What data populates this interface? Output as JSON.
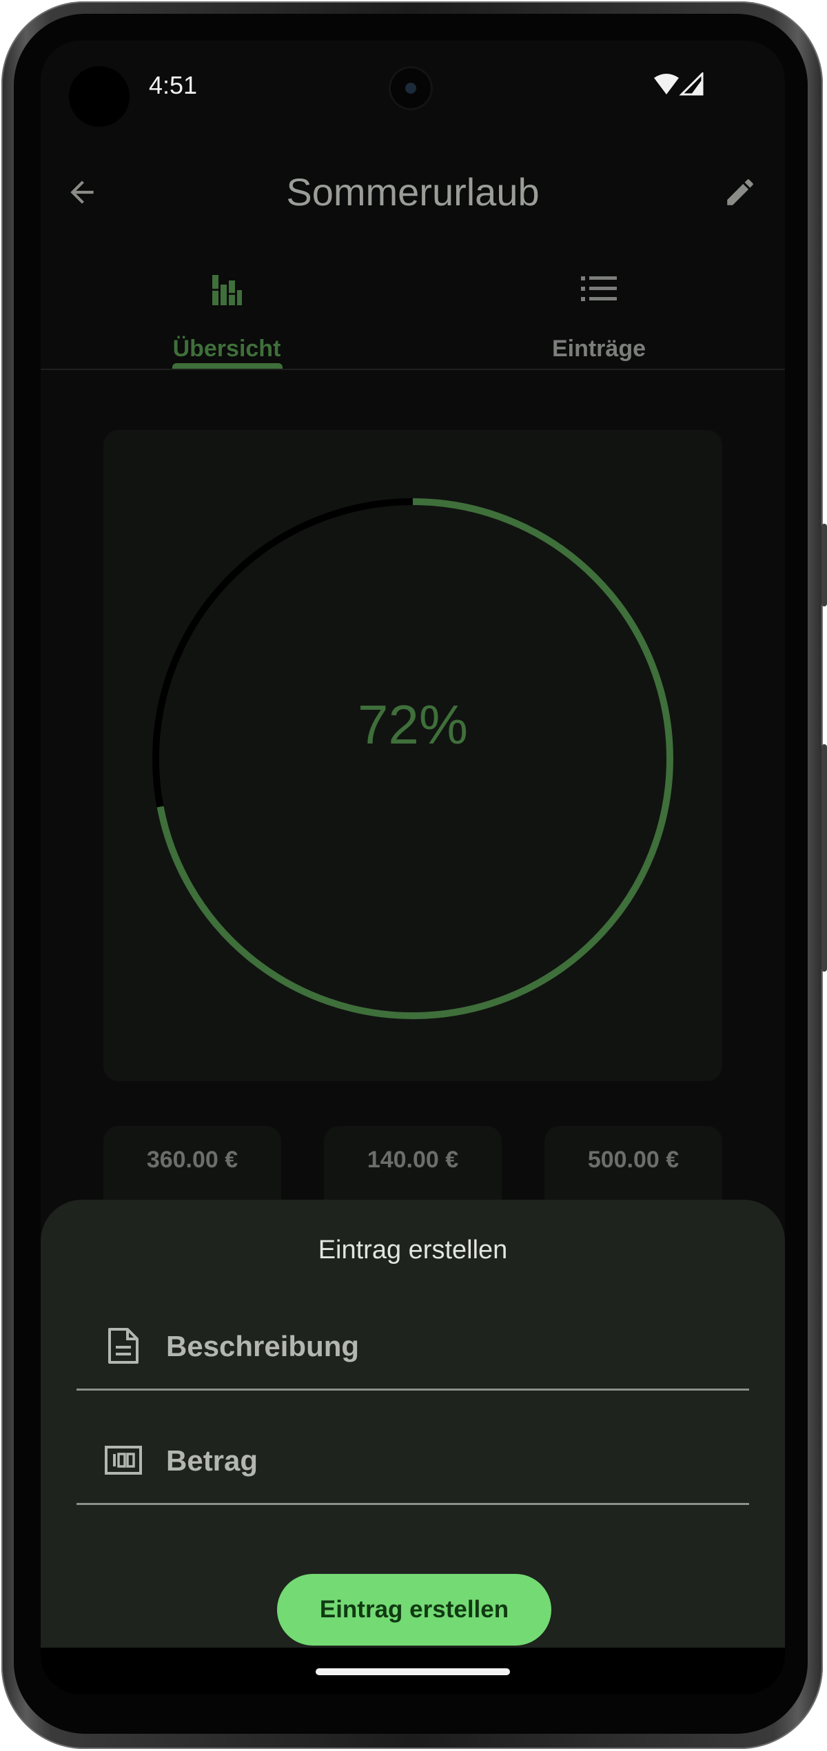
{
  "status_bar": {
    "time": "4:51",
    "wifi_icon": "wifi-icon",
    "signal_icon": "cell-signal-icon"
  },
  "app_bar": {
    "title": "Sommerurlaub",
    "back_icon": "arrow-back-icon",
    "edit_icon": "pencil-icon"
  },
  "tabs": [
    {
      "label": "Übersicht",
      "icon": "bar-chart-icon",
      "selected": true
    },
    {
      "label": "Einträge",
      "icon": "list-icon",
      "selected": false
    }
  ],
  "overview": {
    "progress": 0.72,
    "progress_label": "72%",
    "stats": [
      "360.00 €",
      "140.00 €",
      "500.00 €"
    ]
  },
  "sheet": {
    "title": "Eintrag erstellen",
    "description_placeholder": "Beschreibung",
    "description_icon": "document-icon",
    "amount_placeholder": "Betrag",
    "amount_icon": "banknote-icon",
    "submit_label": "Eintrag erstellen"
  },
  "colors": {
    "accent": "#3f6f3a",
    "button": "#74da74",
    "sheet_background": "#1e231d",
    "card_background": "#111311",
    "screen_background": "#0a0b0a"
  }
}
